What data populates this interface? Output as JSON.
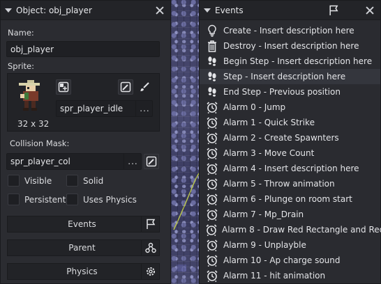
{
  "object_panel": {
    "title": "Object: obj_player",
    "name_label": "Name:",
    "name_value": "obj_player",
    "sprite_label": "Sprite:",
    "sprite_name": "spr_player_idle",
    "sprite_size": "32 x 32",
    "sprite_dots": "...",
    "collision_mask_label": "Collision Mask:",
    "collision_mask_value": "spr_player_col",
    "mask_dots": "...",
    "checkboxes": {
      "visible": "Visible",
      "solid": "Solid",
      "persistent": "Persistent",
      "uses_physics": "Uses Physics"
    },
    "buttons": {
      "events": "Events",
      "parent": "Parent",
      "physics": "Physics"
    }
  },
  "events_panel": {
    "title": "Events",
    "events": [
      {
        "label": "Create - Insert description here",
        "icon": "lightbulb-icon"
      },
      {
        "label": "Destroy - Insert description here",
        "icon": "trash-icon"
      },
      {
        "label": "Begin Step - Insert description here",
        "icon": "footsteps-icon"
      },
      {
        "label": "Step - Insert description here",
        "icon": "footsteps-icon"
      },
      {
        "label": "End Step - Previous position",
        "icon": "footsteps-icon"
      },
      {
        "label": "Alarm 0 - Jump",
        "icon": "alarm-clock-icon"
      },
      {
        "label": "Alarm 1 - Quick Strike",
        "icon": "alarm-clock-icon"
      },
      {
        "label": "Alarm 2 - Create Spawnters",
        "icon": "alarm-clock-icon"
      },
      {
        "label": "Alarm 3 - Move Count",
        "icon": "alarm-clock-icon"
      },
      {
        "label": "Alarm 4 - Insert description here",
        "icon": "alarm-clock-icon"
      },
      {
        "label": "Alarm 5 - Throw animation",
        "icon": "alarm-clock-icon"
      },
      {
        "label": "Alarm 6 - Plunge on room start",
        "icon": "alarm-clock-icon"
      },
      {
        "label": "Alarm 7 - Mp_Drain",
        "icon": "alarm-clock-icon"
      },
      {
        "label": "Alarm 8 - Draw Red Rectangle and Red",
        "icon": "alarm-clock-icon"
      },
      {
        "label": "Alarm 9 - Unplayble",
        "icon": "alarm-clock-icon"
      },
      {
        "label": "Alarm 10 - Ap charge sound",
        "icon": "alarm-clock-icon"
      },
      {
        "label": "Alarm 11 - hit animation",
        "icon": "alarm-clock-icon"
      }
    ],
    "selected_index": 3
  },
  "colors": {
    "panel_bg": "#2b2c31",
    "header_bg": "#232428",
    "field_bg": "#1f2024",
    "text": "#dcdde0",
    "selected_row": "#34363d"
  }
}
